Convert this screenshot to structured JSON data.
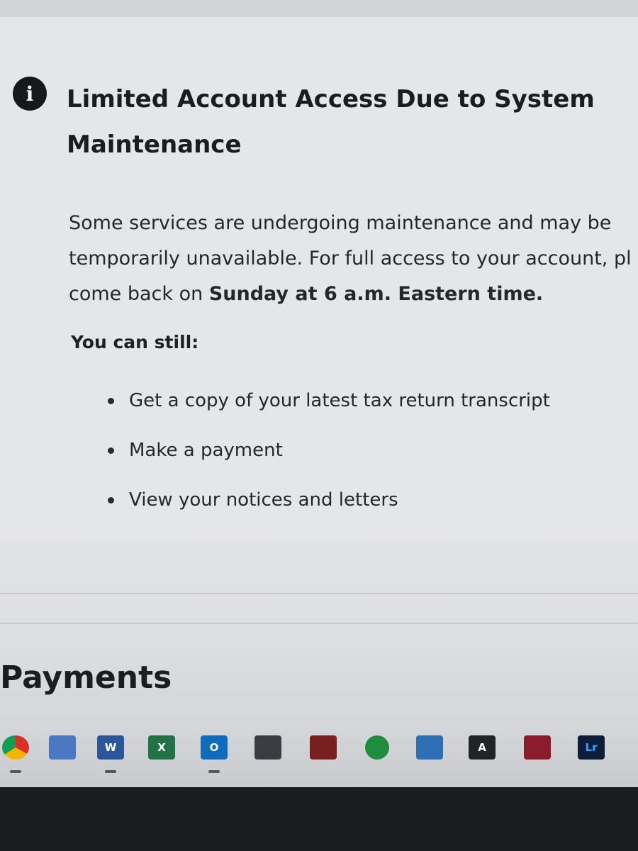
{
  "alert": {
    "icon": "info-icon",
    "title": "Limited Account Access Due to System Maintenance",
    "body_line1": "Some services are undergoing maintenance and may be",
    "body_line2": "temporarily unavailable. For full access to your account, pl",
    "body_line3_prefix": "come back on ",
    "body_line3_bold": "Sunday at 6 a.m. Eastern time.",
    "still_heading": "You can still:",
    "items": [
      "Get a copy of your latest tax return transcript",
      "Make a payment",
      "View your notices and letters"
    ]
  },
  "payments": {
    "heading": "Payments"
  },
  "taskbar": {
    "apps": [
      {
        "icon": "chrome-icon",
        "color": "#d93025"
      },
      {
        "icon": "remote-desktop-icon",
        "color": "#4a78c2"
      },
      {
        "icon": "word-icon",
        "color": "#2b579a",
        "glyph": "W"
      },
      {
        "icon": "excel-icon",
        "color": "#217346",
        "glyph": "X"
      },
      {
        "icon": "outlook-icon",
        "color": "#0f6cbd",
        "glyph": "O"
      },
      {
        "icon": "calculator-icon",
        "color": "#3a3d42"
      },
      {
        "icon": "app-icon",
        "color": "#7a1f1f"
      },
      {
        "icon": "maps-icon",
        "color": "#1e8e3e"
      },
      {
        "icon": "photos-icon",
        "color": "#2f6fb5"
      },
      {
        "icon": "affinity-icon",
        "color": "#222327",
        "glyph": "A"
      },
      {
        "icon": "acrobat-icon",
        "color": "#8b1c2c"
      },
      {
        "icon": "lightroom-icon",
        "color": "#0b1d3a",
        "glyph": "Lr"
      }
    ]
  }
}
